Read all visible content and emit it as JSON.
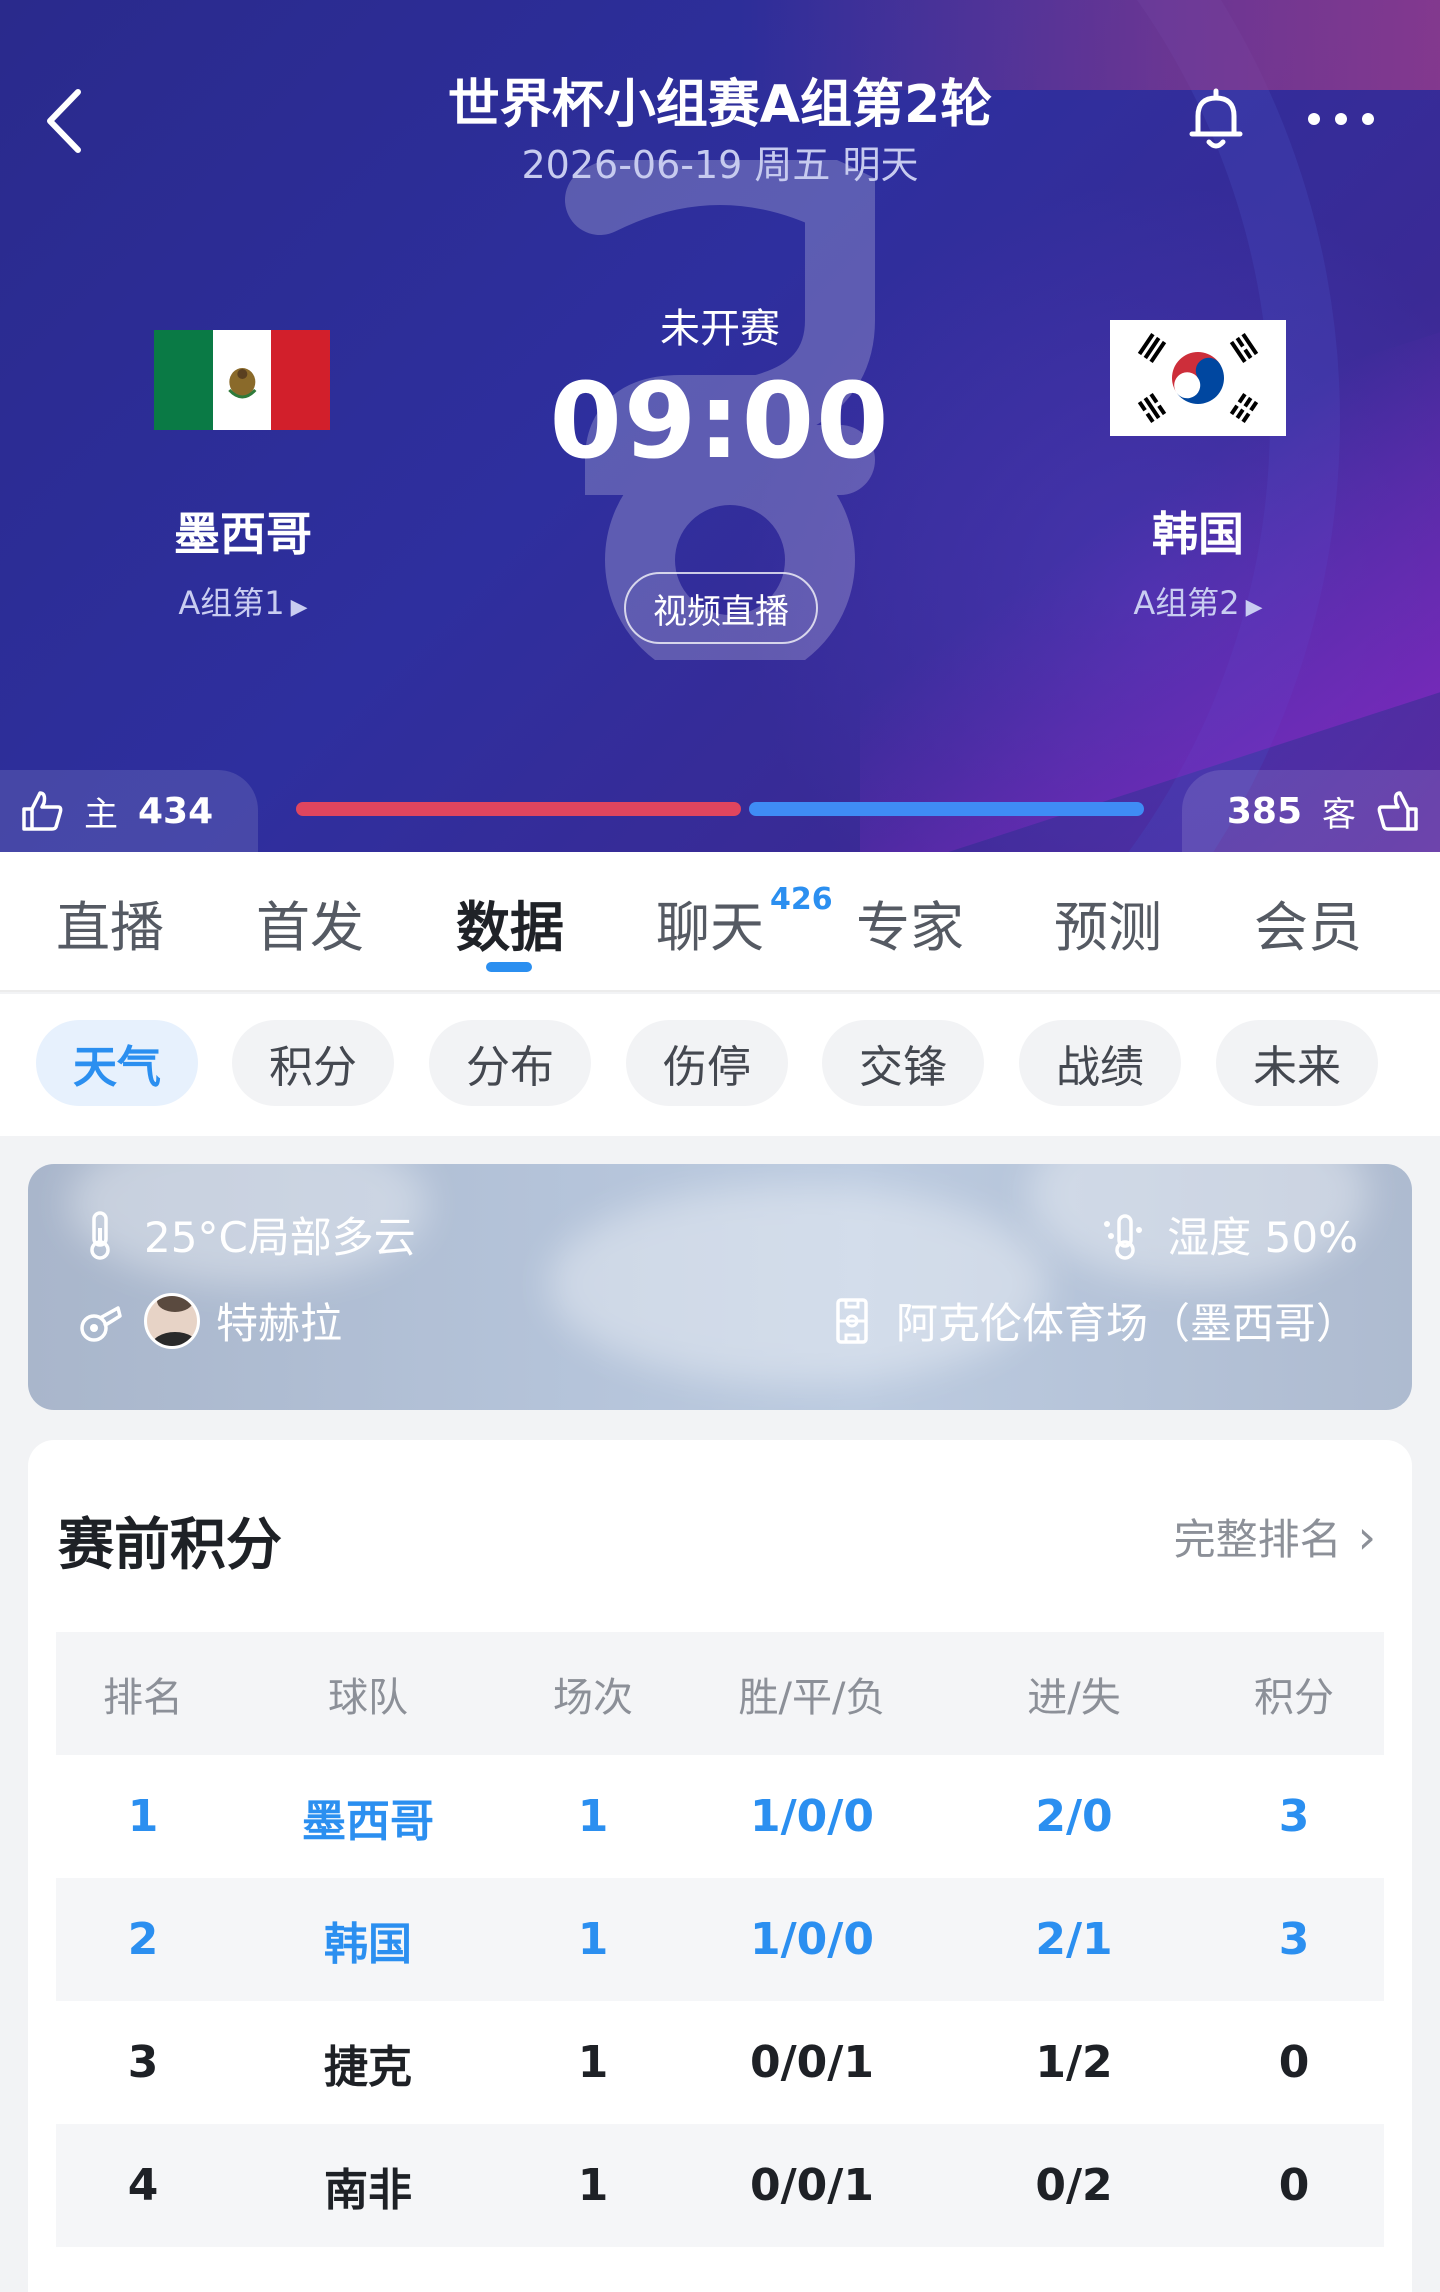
{
  "header": {
    "title": "世界杯小组赛A组第2轮",
    "subtitle": "2026-06-19 周五 明天"
  },
  "match": {
    "status": "未开赛",
    "time": "09:00",
    "live_button": "视频直播",
    "home": {
      "name": "墨西哥",
      "rank": "A组第1"
    },
    "away": {
      "name": "韩国",
      "rank": "A组第2"
    }
  },
  "votes": {
    "home_label": "主",
    "home_count": "434",
    "away_label": "客",
    "away_count": "385",
    "home_share": 0.53,
    "home_color": "#e0455e",
    "away_color": "#3f8cf5"
  },
  "tabs": [
    {
      "label": "直播"
    },
    {
      "label": "首发"
    },
    {
      "label": "数据",
      "active": true
    },
    {
      "label": "聊天",
      "badge": "426"
    },
    {
      "label": "专家"
    },
    {
      "label": "预测"
    },
    {
      "label": "会员"
    }
  ],
  "chips": [
    {
      "label": "天气",
      "active": true
    },
    {
      "label": "积分"
    },
    {
      "label": "分布"
    },
    {
      "label": "伤停"
    },
    {
      "label": "交锋"
    },
    {
      "label": "战绩"
    },
    {
      "label": "未来"
    }
  ],
  "weather": {
    "temp": "25°C局部多云",
    "humidity": "湿度 50%",
    "referee": "特赫拉",
    "venue": "阿克伦体育场（墨西哥）"
  },
  "standings": {
    "title": "赛前积分",
    "link": "完整排名",
    "columns": [
      "排名",
      "球队",
      "场次",
      "胜/平/负",
      "进/失",
      "积分"
    ],
    "rows": [
      [
        "1",
        "墨西哥",
        "1",
        "1/0/0",
        "2/0",
        "3"
      ],
      [
        "2",
        "韩国",
        "1",
        "1/0/0",
        "2/1",
        "3"
      ],
      [
        "3",
        "捷克",
        "1",
        "0/0/1",
        "1/2",
        "0"
      ],
      [
        "4",
        "南非",
        "1",
        "0/0/1",
        "0/2",
        "0"
      ]
    ]
  },
  "accent": "#2b8ff0"
}
